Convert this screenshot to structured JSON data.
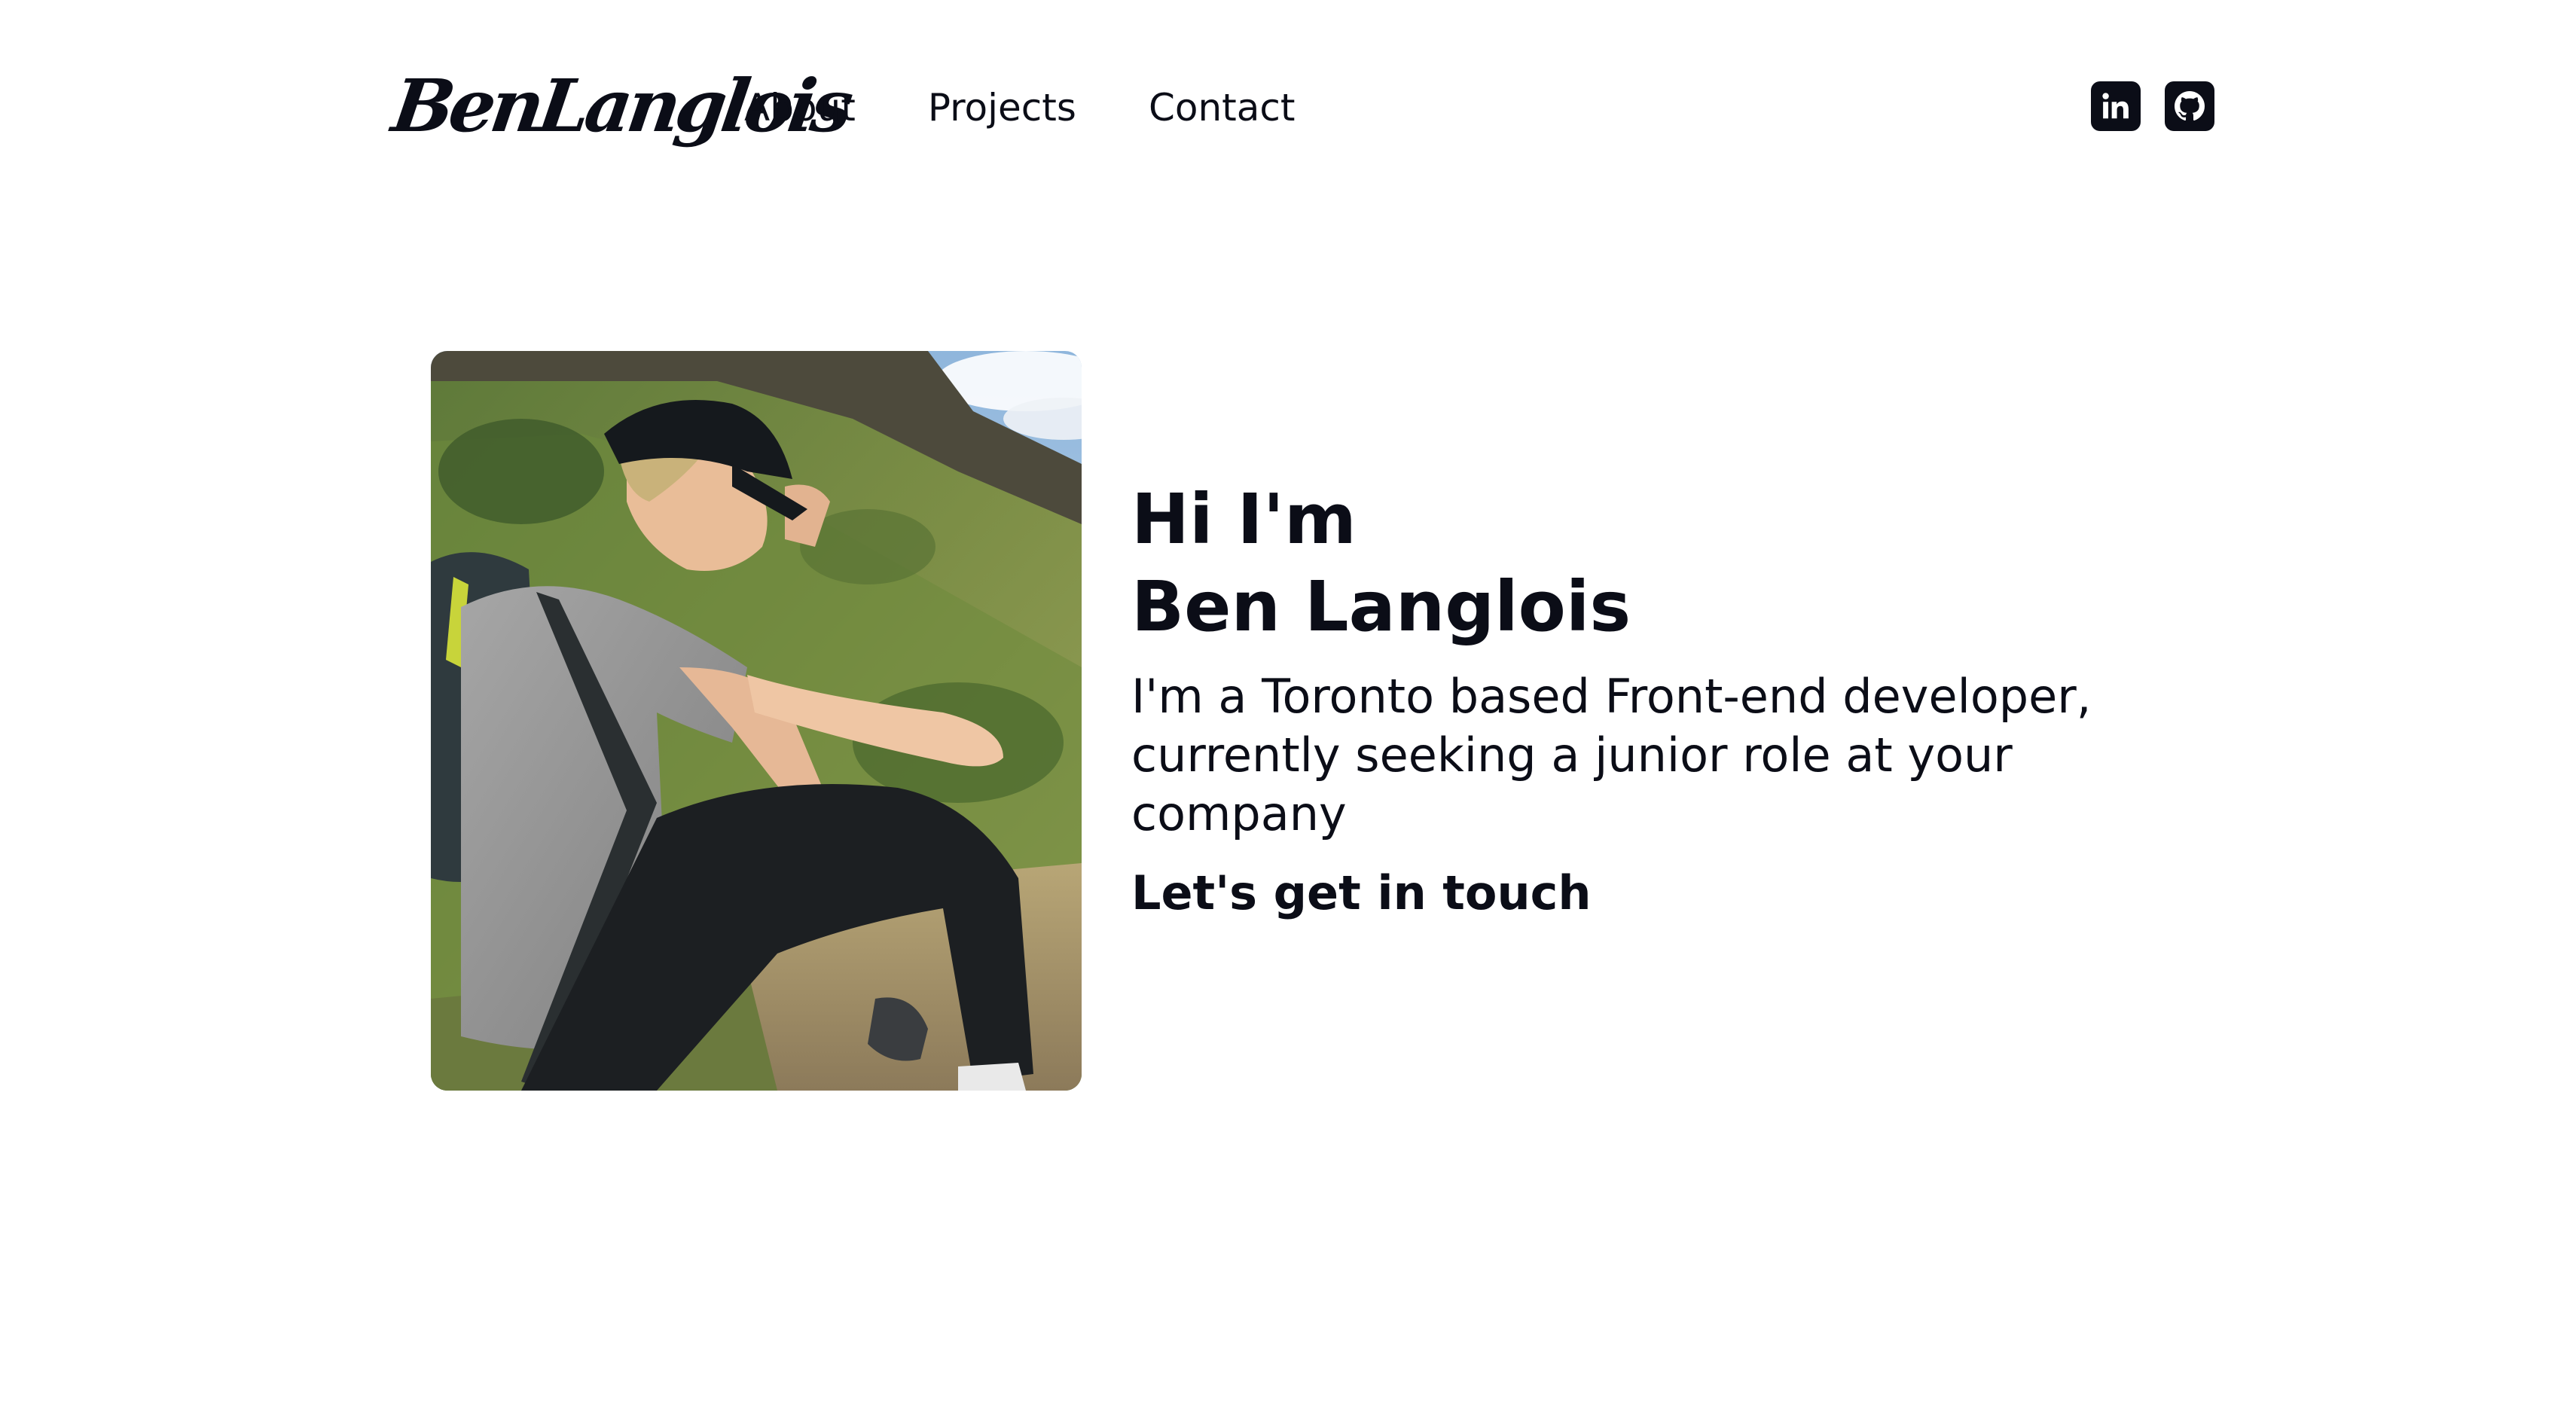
{
  "header": {
    "logo_text": "BenLanglois",
    "nav": [
      {
        "label": "About"
      },
      {
        "label": "Projects"
      },
      {
        "label": "Contact"
      }
    ],
    "social": [
      {
        "icon": "linkedin-icon"
      },
      {
        "icon": "github-icon"
      }
    ]
  },
  "hero": {
    "greeting_line1": "Hi I'm",
    "greeting_line2": "Ben Langlois",
    "tagline": "I'm a Toronto based Front-end developer, currently seeking a junior role at your company",
    "cta_label": "Let's get in touch"
  },
  "colors": {
    "text": "#0b0d17",
    "background": "#ffffff"
  }
}
